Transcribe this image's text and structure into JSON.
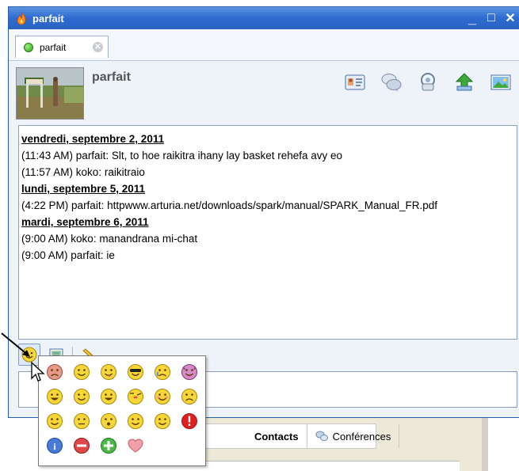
{
  "window": {
    "title": "parfait",
    "minimize_glyph": "_",
    "maximize_glyph": "□",
    "close_glyph": "✕"
  },
  "tab": {
    "label": "parfait",
    "close_glyph": "✕"
  },
  "contact": {
    "name": "parfait"
  },
  "header_icons": [
    "vcard-icon",
    "chat-history-icon",
    "phone-icon",
    "send-file-icon",
    "screenshot-icon"
  ],
  "transcript": {
    "days": [
      {
        "date": "vendredi, septembre 2, 2011",
        "messages": [
          {
            "time": "(11:43 AM)",
            "sender": "parfait:",
            "text": "Slt, to hoe raikitra ihany lay basket rehefa avy eo"
          },
          {
            "time": "(11:57 AM)",
            "sender": "koko:",
            "text": "raikitraio"
          }
        ]
      },
      {
        "date": "lundi, septembre 5, 2011",
        "messages": [
          {
            "time": "(4:22 PM)",
            "sender": "parfait:",
            "text": "httpwww.arturia.net/downloads/spark/manual/SPARK_Manual_FR.pdf"
          }
        ]
      },
      {
        "date": "mardi, septembre 6, 2011",
        "messages": [
          {
            "time": "(9:00 AM)",
            "sender": "koko:",
            "text": "manandrana mi-chat"
          },
          {
            "time": "(9:00 AM)",
            "sender": "parfait:",
            "text": "ie"
          }
        ]
      }
    ]
  },
  "toolbar": {
    "buttons": [
      "emoticon-button",
      "insert-picture-button",
      "pen-button"
    ]
  },
  "emoticons": {
    "rows": [
      [
        "angry-emoticon",
        "smile-emoticon",
        "tongue-emoticon",
        "cool-emoticon",
        "cry-emoticon",
        "devil-emoticon"
      ],
      [
        "grin-emoticon",
        "happy-emoticon",
        "laugh-emoticon",
        "kiss-emoticon",
        "blush-emoticon",
        "sad-emoticon"
      ],
      [
        "smile2-emoticon",
        "plain-emoticon",
        "surprised-emoticon",
        "smile3-emoticon",
        "wink-emoticon",
        "alert-emoticon"
      ],
      [
        "info-emoticon",
        "minus-emoticon",
        "plus-emoticon",
        "heart-emoticon"
      ]
    ]
  },
  "background_window": {
    "tabs": [
      {
        "label": "Contacts"
      },
      {
        "label": "Conférences"
      }
    ]
  },
  "colors": {
    "titlebar": "#2e6bd0",
    "emoticon_yellow": "#f7d737",
    "alert_red": "#e02020"
  }
}
